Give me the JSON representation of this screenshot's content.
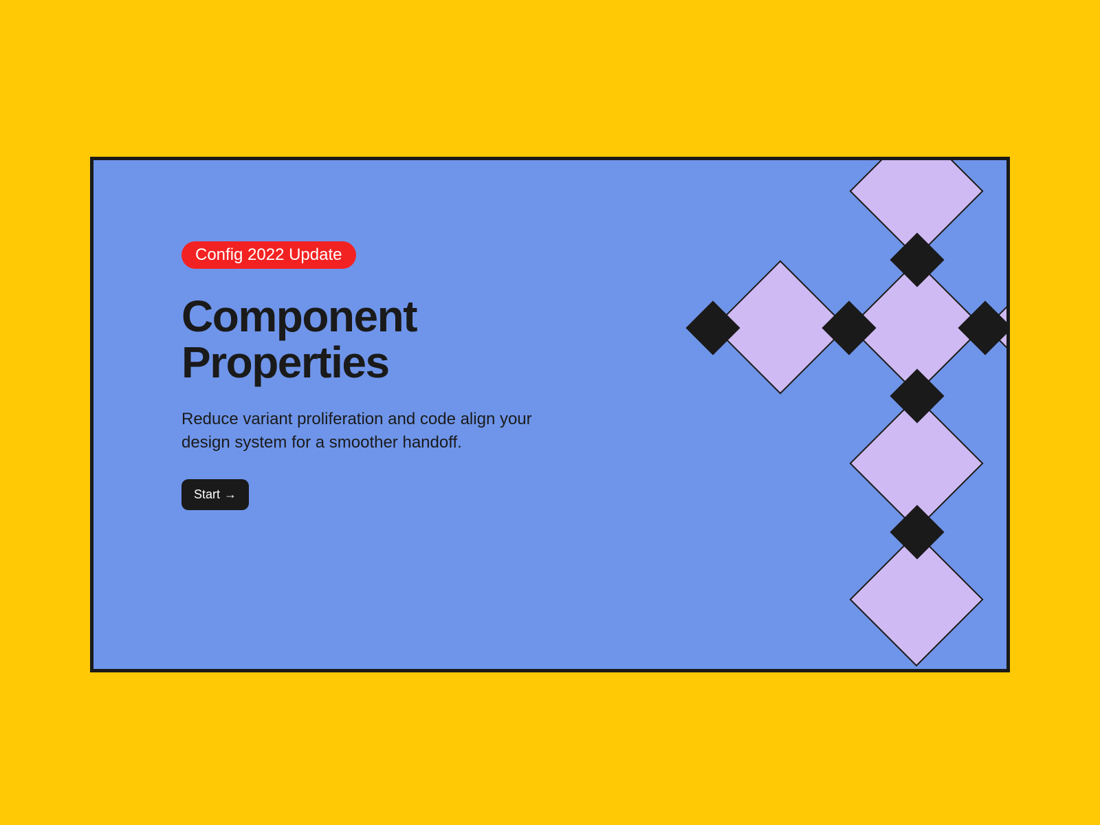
{
  "card": {
    "badge_label": "Config 2022 Update",
    "title": "Component Properties",
    "subtitle": "Reduce variant proliferation and code align your design system for a smoother handoff.",
    "button_label": "Start",
    "button_arrow": "→"
  },
  "colors": {
    "page_bg": "#ffc905",
    "card_bg": "#6f95ea",
    "card_border": "#1a1a1a",
    "badge_bg": "#f32222",
    "badge_text": "#ffffff",
    "title_text": "#1a1a1a",
    "subtitle_text": "#1a1a1a",
    "button_bg": "#1a1a1a",
    "button_text": "#ffffff",
    "diamond_fill": "#cfbaf3",
    "diamond_stroke": "#1a1a1a",
    "diamond_small_fill": "#1a1a1a"
  }
}
